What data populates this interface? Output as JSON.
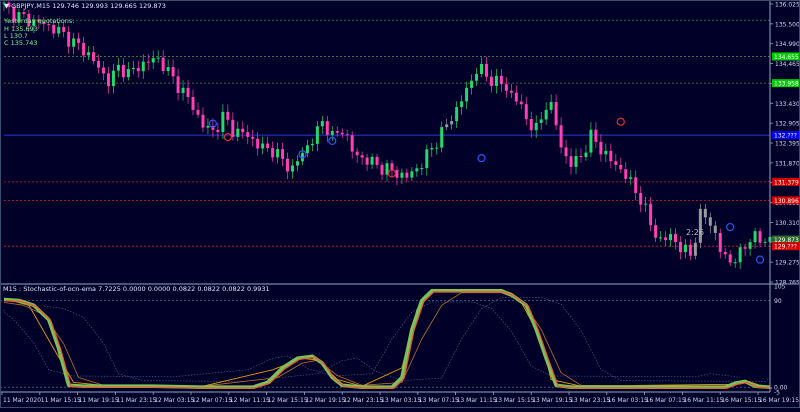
{
  "header": {
    "symbol": "GBPJPY,M15",
    "ohlc": "129.746 129.993 129.665 129.873",
    "yesterday_label": "Yesterday quotations:",
    "yesterday_high": "H   135.693",
    "yesterday_low": "L   130.?",
    "yesterday_close": "C   135.743"
  },
  "indicator": {
    "title": "M15 : Stochastic-of-ocn-ema 7.7225 0.0000 0.0000 0.0822 0.0822 0.0822 0.9931",
    "levels": [
      "105",
      "90",
      "0.00",
      "-5"
    ]
  },
  "chart": {
    "countdown": "2:26",
    "current_price": "129.873",
    "price_ticks": [
      "136.025",
      "135.500",
      "134.990",
      "134.465",
      "133.940",
      "133.430",
      "132.905",
      "132.395",
      "131.870",
      "131.360",
      "130.835",
      "130.310",
      "129.785",
      "129.275",
      "128.765"
    ],
    "level_tags": [
      {
        "text": "134.655",
        "color": "#00cc00"
      },
      {
        "text": "133.958",
        "color": "#00cc00"
      },
      {
        "text": "131.379",
        "color": "#d40000"
      },
      {
        "text": "130.896",
        "color": "#d40000"
      },
      {
        "text": "129.873",
        "color": "#2e6b2e"
      },
      {
        "text": "129.???",
        "color": "#d40000"
      },
      {
        "text": "132.???",
        "color": "#0000ff"
      }
    ],
    "time_labels": [
      "11 Mar 2020",
      "11 Mar 15:15",
      "11 Mar 19:15",
      "11 Mar 23:15",
      "12 Mar 03:15",
      "12 Mar 07:15",
      "12 Mar 11:15",
      "12 Mar 15:15",
      "12 Mar 19:15",
      "12 Mar 23:15",
      "13 Mar 03:15",
      "13 Mar 07:15",
      "13 Mar 11:15",
      "13 Mar 15:15",
      "13 Mar 19:15",
      "13 Mar 23:15",
      "16 Mar 03:15",
      "16 Mar 07:15",
      "16 Mar 11:15",
      "16 Mar 15:15",
      "16 Mar 19:15"
    ],
    "colors": {
      "background": "#000028",
      "bull": "#23d96a",
      "bear": "#ff3fb2",
      "neutral": "#9a9a9a",
      "support_line": "#e02020",
      "resistance_line": "#4a8c3a",
      "pivot_line": "#2a38d8",
      "osc_green": "#7bc25a",
      "osc_red": "#e0603a",
      "osc_orange": "#e8a000"
    }
  },
  "chart_data": {
    "type": "candlestick",
    "ylim": [
      128.765,
      136.025
    ],
    "close_points": [
      [
        0,
        136.05
      ],
      [
        3,
        135.75
      ],
      [
        6,
        135.6
      ],
      [
        9,
        135.5
      ],
      [
        12,
        135.3
      ],
      [
        15,
        135.0
      ],
      [
        18,
        134.7
      ],
      [
        20,
        134.3
      ],
      [
        22,
        134.0
      ],
      [
        24,
        134.4
      ],
      [
        26,
        134.2
      ],
      [
        29,
        134.5
      ],
      [
        32,
        134.6
      ],
      [
        34,
        134.2
      ],
      [
        37,
        133.7
      ],
      [
        39,
        133.3
      ],
      [
        41,
        132.8
      ],
      [
        43,
        132.7
      ],
      [
        45,
        133.1
      ],
      [
        47,
        132.7
      ],
      [
        50,
        132.6
      ],
      [
        52,
        132.3
      ],
      [
        55,
        132.2
      ],
      [
        57,
        131.9
      ],
      [
        59,
        131.7
      ],
      [
        61,
        132.2
      ],
      [
        63,
        132.5
      ],
      [
        65,
        133.0
      ],
      [
        67,
        132.5
      ],
      [
        69,
        132.8
      ],
      [
        71,
        132.1
      ],
      [
        73,
        132.0
      ],
      [
        76,
        131.8
      ],
      [
        79,
        131.65
      ],
      [
        82,
        131.5
      ],
      [
        85,
        131.9
      ],
      [
        88,
        132.5
      ],
      [
        91,
        133.1
      ],
      [
        94,
        133.8
      ],
      [
        96,
        134.4
      ],
      [
        98,
        134.1
      ],
      [
        100,
        134.0
      ],
      [
        102,
        133.8
      ],
      [
        104,
        133.5
      ],
      [
        106,
        133.0
      ],
      [
        108,
        132.7
      ],
      [
        110,
        133.5
      ],
      [
        111,
        133.3
      ],
      [
        113,
        132.2
      ],
      [
        115,
        131.8
      ],
      [
        117,
        132.1
      ],
      [
        119,
        132.6
      ],
      [
        121,
        132.2
      ],
      [
        123,
        131.9
      ],
      [
        125,
        131.7
      ],
      [
        127,
        131.3
      ],
      [
        129,
        130.9
      ],
      [
        131,
        130.2
      ],
      [
        133,
        129.8
      ],
      [
        135,
        130.0
      ],
      [
        137,
        129.6
      ],
      [
        139,
        129.5
      ],
      [
        141,
        130.6
      ],
      [
        143,
        130.3
      ],
      [
        145,
        129.5
      ],
      [
        147,
        129.3
      ],
      [
        149,
        129.5
      ],
      [
        151,
        130.0
      ],
      [
        153,
        129.8
      ],
      [
        154,
        129.9
      ]
    ],
    "signal_markers": [
      {
        "type": "buy-circle",
        "index": 42,
        "price": 132.9
      },
      {
        "type": "sell-circle",
        "index": 45,
        "price": 132.55
      },
      {
        "type": "buy-circle",
        "index": 60,
        "price": 132.1
      },
      {
        "type": "buy-circle",
        "index": 66,
        "price": 132.45
      },
      {
        "type": "sell-circle",
        "index": 78,
        "price": 131.6
      },
      {
        "type": "buy-circle",
        "index": 96,
        "price": 132.0
      },
      {
        "type": "sell-circle",
        "index": 124,
        "price": 132.95
      },
      {
        "type": "buy-circle",
        "index": 146,
        "price": 130.2
      },
      {
        "type": "buy-circle",
        "index": 152,
        "price": 129.35
      }
    ],
    "horizontal_levels": [
      {
        "price": 135.6,
        "color": "resistance_line"
      },
      {
        "price": 134.655,
        "color": "resistance_line"
      },
      {
        "price": 133.958,
        "color": "resistance_line"
      },
      {
        "price": 132.6,
        "color": "pivot_line"
      },
      {
        "price": 131.379,
        "color": "support_line"
      },
      {
        "price": 130.896,
        "color": "support_line"
      },
      {
        "price": 129.7,
        "color": "support_line"
      }
    ],
    "oscillator": {
      "ylim": [
        -5,
        105
      ],
      "main": [
        [
          0,
          91
        ],
        [
          3,
          90
        ],
        [
          6,
          85
        ],
        [
          9,
          70
        ],
        [
          11,
          40
        ],
        [
          13,
          2
        ],
        [
          16,
          1
        ],
        [
          30,
          1
        ],
        [
          40,
          0
        ],
        [
          50,
          0
        ],
        [
          53,
          5
        ],
        [
          56,
          20
        ],
        [
          59,
          30
        ],
        [
          62,
          32
        ],
        [
          64,
          25
        ],
        [
          66,
          10
        ],
        [
          68,
          2
        ],
        [
          72,
          0
        ],
        [
          78,
          0
        ],
        [
          80,
          10
        ],
        [
          82,
          60
        ],
        [
          84,
          90
        ],
        [
          86,
          100
        ],
        [
          90,
          100
        ],
        [
          100,
          100
        ],
        [
          102,
          96
        ],
        [
          105,
          85
        ],
        [
          107,
          60
        ],
        [
          109,
          30
        ],
        [
          111,
          2
        ],
        [
          114,
          0
        ],
        [
          130,
          0
        ],
        [
          140,
          0
        ],
        [
          145,
          0
        ],
        [
          147,
          4
        ],
        [
          149,
          6
        ],
        [
          151,
          1
        ],
        [
          154,
          0
        ]
      ]
    },
    "oscillator_smooth": [
      [
        0,
        88
      ],
      [
        4,
        85
      ],
      [
        8,
        75
      ],
      [
        12,
        45
      ],
      [
        15,
        10
      ],
      [
        20,
        2
      ],
      [
        40,
        1
      ],
      [
        55,
        10
      ],
      [
        60,
        25
      ],
      [
        63,
        28
      ],
      [
        67,
        12
      ],
      [
        72,
        2
      ],
      [
        80,
        5
      ],
      [
        84,
        50
      ],
      [
        88,
        85
      ],
      [
        92,
        98
      ],
      [
        100,
        98
      ],
      [
        104,
        90
      ],
      [
        108,
        60
      ],
      [
        112,
        15
      ],
      [
        116,
        2
      ],
      [
        145,
        1
      ],
      [
        148,
        5
      ],
      [
        152,
        2
      ],
      [
        154,
        0
      ]
    ],
    "oscillator_fast": [
      [
        0,
        92
      ],
      [
        5,
        85
      ],
      [
        10,
        40
      ],
      [
        14,
        5
      ],
      [
        20,
        2
      ],
      [
        40,
        1
      ],
      [
        54,
        18
      ],
      [
        60,
        30
      ],
      [
        63,
        28
      ],
      [
        67,
        8
      ],
      [
        72,
        1
      ],
      [
        80,
        20
      ],
      [
        83,
        80
      ],
      [
        86,
        100
      ],
      [
        100,
        100
      ],
      [
        104,
        88
      ],
      [
        108,
        50
      ],
      [
        110,
        8
      ],
      [
        116,
        1
      ],
      [
        146,
        3
      ],
      [
        149,
        7
      ],
      [
        152,
        2
      ],
      [
        154,
        0
      ]
    ]
  }
}
